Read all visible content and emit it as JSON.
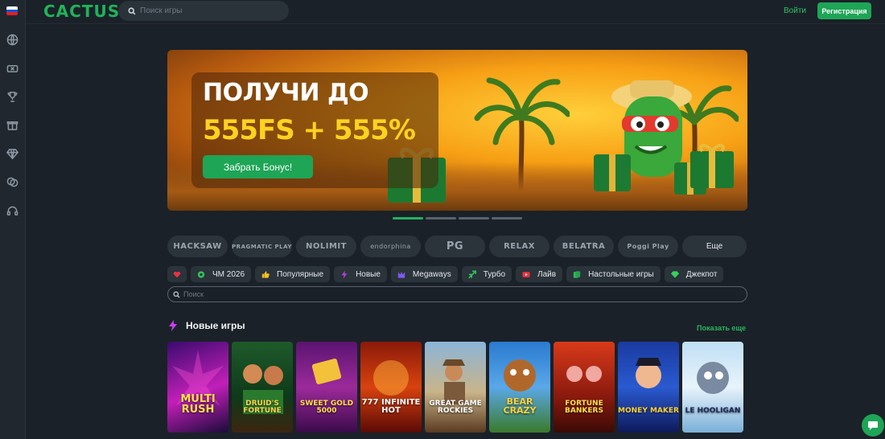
{
  "header": {
    "logo_text": "CACTUS",
    "search_placeholder": "Поиск игры",
    "login_label": "Войти",
    "register_label": "Регистрация",
    "language_flag": "ru-flag"
  },
  "sidebar": {
    "icons": [
      "globe-icon",
      "ticket-icon",
      "trophy-icon",
      "gift-icon",
      "diamond-icon",
      "chips-icon",
      "headset-icon"
    ]
  },
  "banner": {
    "line1": "ПОЛУЧИ ДО",
    "line2": "555FS + 555%",
    "button_label": "Забрать Бонус!",
    "slides": 4,
    "active_slide": 1
  },
  "providers": {
    "items": [
      "HACKSAW",
      "PRAGMATIC PLAY",
      "NOLIMIT",
      "endorphina",
      "PG",
      "RELAX",
      "BELATRA",
      "Poggi Play"
    ],
    "more_label": "Еще"
  },
  "categories": [
    {
      "label": "",
      "icon": "heart-icon"
    },
    {
      "label": "ЧМ 2026",
      "icon": "football-icon"
    },
    {
      "label": "Популярные",
      "icon": "thumbs-up-icon"
    },
    {
      "label": "Новые",
      "icon": "lightning-icon"
    },
    {
      "label": "Megaways",
      "icon": "megaways-icon"
    },
    {
      "label": "Турбо",
      "icon": "turbo-icon"
    },
    {
      "label": "Лайв",
      "icon": "live-icon"
    },
    {
      "label": "Настольные игры",
      "icon": "cards-icon"
    },
    {
      "label": "Джекпот",
      "icon": "jackpot-icon"
    }
  ],
  "games_search": {
    "placeholder": "Поиск"
  },
  "new_games": {
    "title": "Новые игры",
    "show_more_label": "Показать еще",
    "items": [
      {
        "title": "MULTI RUSH"
      },
      {
        "title": "DRUID'S FORTUNE"
      },
      {
        "title": "SWEET GOLD 5000"
      },
      {
        "title": "777 INFINITE HOT"
      },
      {
        "title": "GREAT GAME ROCKIES"
      },
      {
        "title": "BEAR CRAZY"
      },
      {
        "title": "FORTUNE BANKERS"
      },
      {
        "title": "MONEY MAKER"
      },
      {
        "title": "LE HOOLIGAN"
      }
    ]
  },
  "colors": {
    "accent": "#1ea556",
    "background": "#1b2128",
    "chip": "#2b333b"
  }
}
